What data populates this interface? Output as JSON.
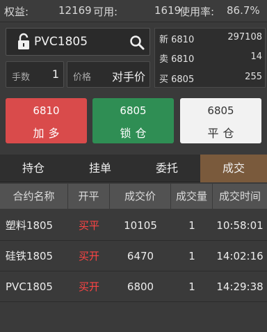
{
  "account": {
    "equity_label": "权益:",
    "equity_value": "12169",
    "available_label": "可用:",
    "available_value": "1619",
    "usage_label": "使用率:",
    "usage_value": "86.7%"
  },
  "order": {
    "symbol": "PVC1805",
    "qty_label": "手数",
    "qty_value": "1",
    "price_label": "价格",
    "price_value": "对手价"
  },
  "quote": [
    {
      "label": "新 6810",
      "value": "297108"
    },
    {
      "label": "卖 6810",
      "value": "14"
    },
    {
      "label": "买 6805",
      "value": "255"
    }
  ],
  "buttons": {
    "buy": {
      "price": "6810",
      "text": "加多"
    },
    "lock": {
      "price": "6805",
      "text": "锁仓"
    },
    "close": {
      "price": "6805",
      "text": "平仓"
    }
  },
  "tabs": [
    "持仓",
    "挂单",
    "委托",
    "成交"
  ],
  "active_tab": "成交",
  "table": {
    "headers": [
      "合约名称",
      "开平",
      "成交价",
      "成交量",
      "成交时间"
    ],
    "rows": [
      [
        "塑料1805",
        "买平",
        "10105",
        "1",
        "10:58:01"
      ],
      [
        "硅铁1805",
        "买开",
        "6470",
        "1",
        "14:02:16"
      ],
      [
        "PVC1805",
        "买开",
        "6800",
        "1",
        "14:29:38"
      ]
    ]
  },
  "colors": {
    "buy": "#d94b4b",
    "lock": "#2f8e54",
    "close": "#f2f2f2",
    "active_tab": "#7a5a3c",
    "open_close_text": "#ff4444"
  }
}
